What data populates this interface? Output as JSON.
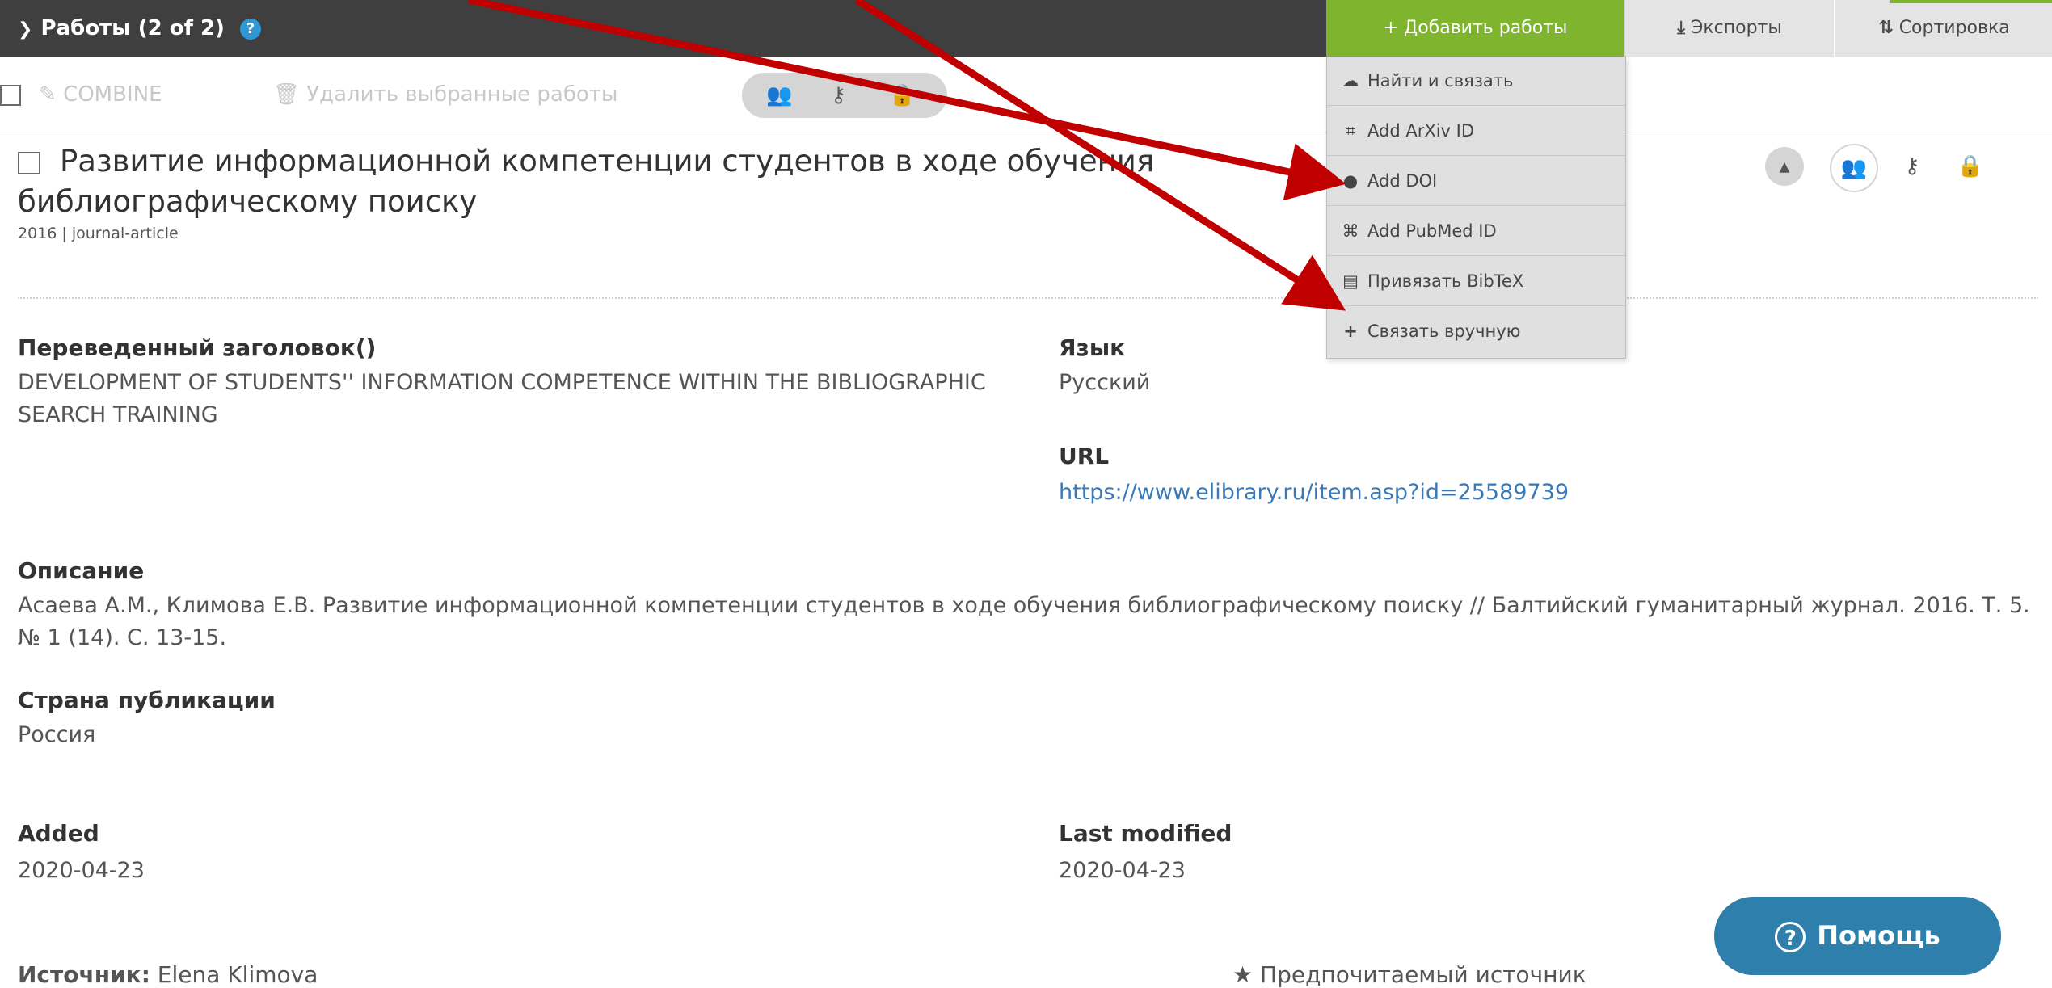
{
  "header": {
    "title": "Работы (2 of 2)",
    "help": "?",
    "add_works": "+ Добавить работы",
    "export": "Экспорты",
    "sort": "Сортировка"
  },
  "toolbar": {
    "combine": "COMBINE",
    "delete": "Удалить выбранные работы"
  },
  "record": {
    "title": "Развитие информационной компетенции студентов в ходе обучения библиографическому поиску",
    "meta": "2016 | journal-article",
    "fields": {
      "translated_title_label": "Переведенный заголовок()",
      "translated_title_value": "DEVELOPMENT OF STUDENTS'' INFORMATION COMPETENCE WITHIN THE BIBLIOGRAPHIC SEARCH TRAINING",
      "language_label": "Язык",
      "language_value": "Русский",
      "url_label": "URL",
      "url_value": "https://www.elibrary.ru/item.asp?id=25589739",
      "description_label": "Описание",
      "description_value": "Асаева А.М., Климова Е.В. Развитие информационной компетенции студентов в ходе обучения библиографическому поиску // Балтийский гуманитарный журнал. 2016. Т. 5. № 1 (14). С. 13-15.",
      "country_label": "Страна публикации",
      "country_value": "Россия",
      "added_label": "Added",
      "added_value": "2020-04-23",
      "modified_label": "Last modified",
      "modified_value": "2020-04-23"
    },
    "source_label": "Источник:",
    "source_value": "Elena Klimova",
    "preferred_source": "Предпочитаемый источник"
  },
  "dropdown": {
    "items": [
      "Найти и связать",
      "Add ArXiv ID",
      "Add DOI",
      "Add PubMed ID",
      "Привязать BibTeX",
      "Связать вручную"
    ]
  },
  "help_button": "Помощь",
  "colors": {
    "header_bg": "#3f3f3f",
    "accent_green": "#7fb52e",
    "help_blue": "#2f7fac",
    "link_blue": "#3979b6",
    "arrow_red": "#c00000"
  }
}
